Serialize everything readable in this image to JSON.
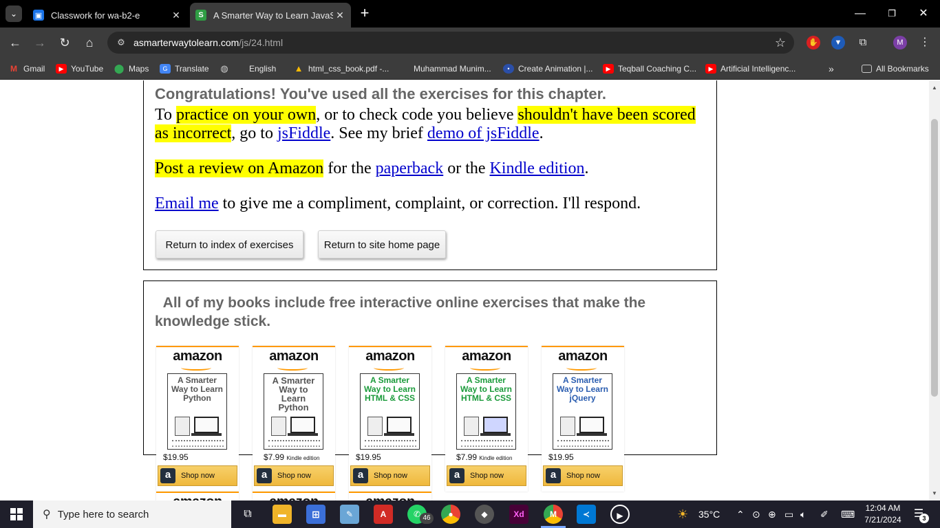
{
  "browser": {
    "tabs": [
      {
        "title": "Classwork for wa-b2-e",
        "favicon": "classroom-icon",
        "active": false
      },
      {
        "title": "A Smarter Way to Learn JavaScr",
        "favicon": "smarter-way-icon",
        "active": true
      }
    ],
    "url_host": "asmarterwaytolearn.com",
    "url_path": "/js/24.html",
    "profile_initial": "M",
    "bookmarks": [
      {
        "label": "Gmail",
        "icon": "gmail-icon"
      },
      {
        "label": "YouTube",
        "icon": "youtube-icon"
      },
      {
        "label": "Maps",
        "icon": "maps-icon"
      },
      {
        "label": "Translate",
        "icon": "translate-icon"
      },
      {
        "label": "English",
        "icon": "globe-icon"
      },
      {
        "label": "html_css_book.pdf -...",
        "icon": "drive-icon"
      },
      {
        "label": "Muhammad Munim...",
        "icon": "blank-icon"
      },
      {
        "label": "Create Animation |...",
        "icon": "animation-icon"
      },
      {
        "label": "Teqball Coaching C...",
        "icon": "youtube-icon"
      },
      {
        "label": "Artificial Intelligenc...",
        "icon": "youtube-icon"
      }
    ],
    "all_bookmarks": "All Bookmarks",
    "colors": {
      "tabstrip": "#000000",
      "toolbar": "#3c3c3c",
      "active_tab": "#3c3c3c"
    }
  },
  "page": {
    "cut_heading": "Congratulations! You've used all the exercises for this chapter.",
    "p1": {
      "t1": "To ",
      "h1": "practice on your own",
      "t2": ", or to check code you believe ",
      "h2": "shouldn't have been scored as incorrect",
      "t3": ", go to ",
      "l1": "jsFiddle",
      "t4": ". See my brief ",
      "l2": "demo of jsFiddle",
      "t5": "."
    },
    "p2": {
      "h1": "Post a review on Amazon",
      "t1": " for the ",
      "l1": "paperback",
      "t2": " or the ",
      "l2": "Kindle edition",
      "t3": "."
    },
    "p3": {
      "l1": "Email me",
      "t1": " to give me a compliment, complaint, or correction. I'll respond."
    },
    "buttons": {
      "index": "Return to index of exercises",
      "home": "Return to site home page"
    },
    "books_heading": "All of my books include free interactive online exercises that make the knowledge stick.",
    "books": [
      {
        "brand": "amazon",
        "cover_title": "A Smarter Way to Learn Python",
        "cover_color": "#555555",
        "price": "$19.95",
        "edition": "",
        "cta": "Shop now"
      },
      {
        "brand": "amazon",
        "cover_title": "A Smarter Way to Learn Python",
        "cover_color": "#555555",
        "price": "$7.99",
        "edition": "Kindle edition",
        "cta": "Shop now"
      },
      {
        "brand": "amazon",
        "cover_title": "A Smarter Way to Learn HTML & CSS",
        "cover_color": "#1a9a3a",
        "price": "$19.95",
        "edition": "",
        "cta": "Shop now"
      },
      {
        "brand": "amazon",
        "cover_title": "A Smarter Way to Learn HTML & CSS",
        "cover_color": "#1a9a3a",
        "price": "$7.99",
        "edition": "Kindle edition",
        "cta": "Shop now"
      },
      {
        "brand": "amazon",
        "cover_title": "A Smarter Way to Learn jQuery",
        "cover_color": "#2a5db0",
        "price": "$19.95",
        "edition": "",
        "cta": "Shop now"
      }
    ],
    "books_row2_brand": "amazon",
    "highlight_color": "#ffff00",
    "link_color": "#0000cc"
  },
  "taskbar": {
    "search_placeholder": "Type here to search",
    "whatsapp_badge": "46",
    "temperature": "35°C",
    "time": "12:04 AM",
    "date": "7/21/2024",
    "notifications": "3"
  }
}
